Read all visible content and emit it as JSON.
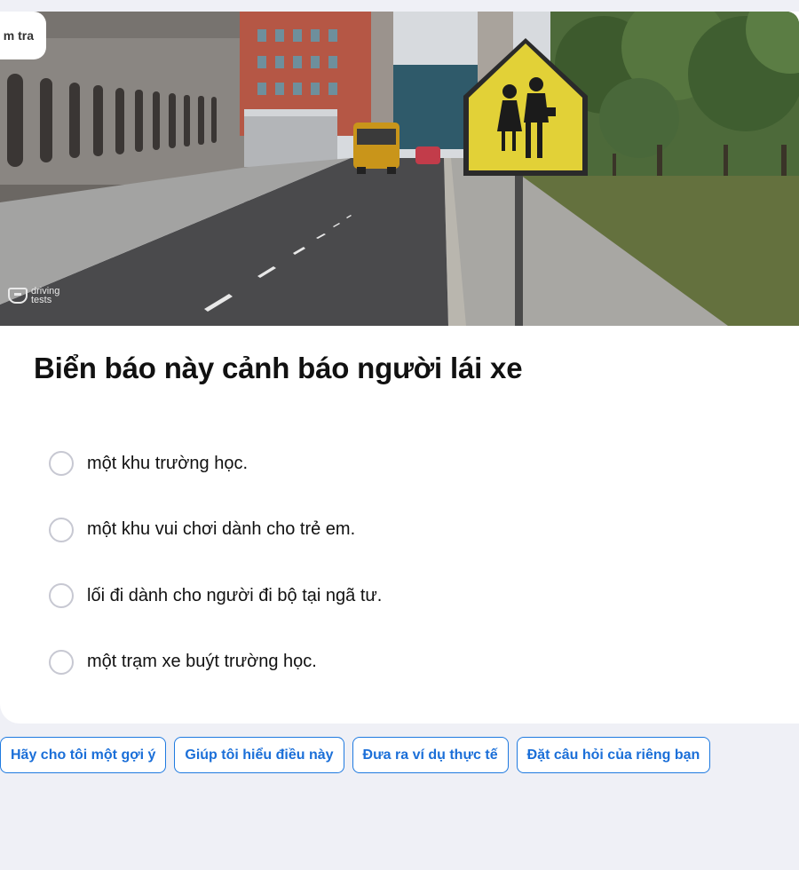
{
  "tab": {
    "label": "m tra"
  },
  "image": {
    "watermark_line1": "driving",
    "watermark_line2": "tests"
  },
  "question": {
    "text": "Biển báo này cảnh báo người lái xe"
  },
  "options": [
    {
      "label": "một khu trường học."
    },
    {
      "label": "một khu vui chơi dành cho trẻ em."
    },
    {
      "label": "lối đi dành cho người đi bộ tại ngã tư."
    },
    {
      "label": "một trạm xe buýt trường học."
    }
  ],
  "chips": [
    {
      "label": "Hãy cho tôi một gợi ý"
    },
    {
      "label": "Giúp tôi hiểu điều này"
    },
    {
      "label": "Đưa ra ví dụ thực tế"
    },
    {
      "label": "Đặt câu hỏi của riêng bạn"
    }
  ],
  "colors": {
    "accent": "#1b6fd8",
    "background": "#eff0f6",
    "sign_yellow": "#e6d33a"
  }
}
